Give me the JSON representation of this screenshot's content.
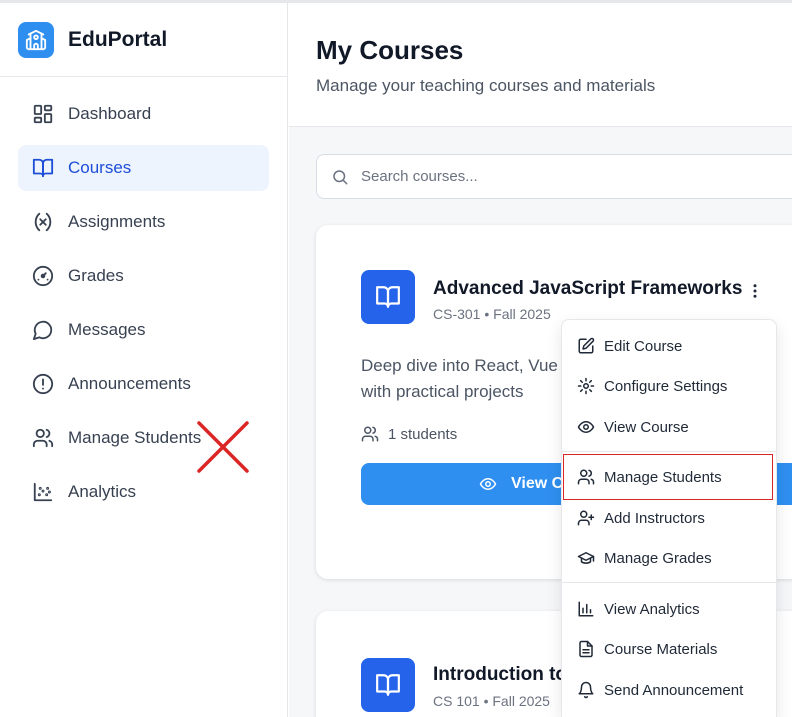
{
  "app": {
    "name": "EduPortal"
  },
  "sidebar": {
    "items": [
      {
        "label": "Dashboard",
        "icon": "dashboard-icon",
        "active": false
      },
      {
        "label": "Courses",
        "icon": "book-open-icon",
        "active": true
      },
      {
        "label": "Assignments",
        "icon": "variable-icon",
        "active": false
      },
      {
        "label": "Grades",
        "icon": "gauge-icon",
        "active": false
      },
      {
        "label": "Messages",
        "icon": "message-circle-icon",
        "active": false
      },
      {
        "label": "Announcements",
        "icon": "alert-circle-icon",
        "active": false
      },
      {
        "label": "Manage Students",
        "icon": "users-icon",
        "active": false
      },
      {
        "label": "Analytics",
        "icon": "scatter-chart-icon",
        "active": false
      }
    ]
  },
  "header": {
    "title": "My Courses",
    "subtitle": "Manage your teaching courses and materials"
  },
  "search": {
    "placeholder": "Search courses...",
    "value": ""
  },
  "courses": [
    {
      "title": "Advanced JavaScript Frameworks",
      "meta": "CS-301 • Fall 2025",
      "description": "Deep dive into React, Vue with practical projects",
      "students": "1 students",
      "view_button": "View C"
    },
    {
      "title": "Introduction to",
      "meta": "CS 101 • Fall 2025"
    }
  ],
  "menu": {
    "items": [
      {
        "label": "Edit Course",
        "icon": "edit-icon"
      },
      {
        "label": "Configure Settings",
        "icon": "settings-icon"
      },
      {
        "label": "View Course",
        "icon": "eye-icon"
      },
      {
        "label": "Manage Students",
        "icon": "users-icon",
        "highlighted": true
      },
      {
        "label": "Add Instructors",
        "icon": "user-plus-icon"
      },
      {
        "label": "Manage Grades",
        "icon": "graduation-cap-icon"
      },
      {
        "label": "View Analytics",
        "icon": "bar-chart-icon"
      },
      {
        "label": "Course Materials",
        "icon": "file-text-icon"
      },
      {
        "label": "Send Announcement",
        "icon": "bell-icon"
      }
    ]
  },
  "colors": {
    "accent": "#2f8ff0",
    "course_icon": "#2563eb",
    "active_nav_bg": "#eef4fd",
    "highlight_border": "#dc2626",
    "annotation_mark": "#dc2626"
  }
}
